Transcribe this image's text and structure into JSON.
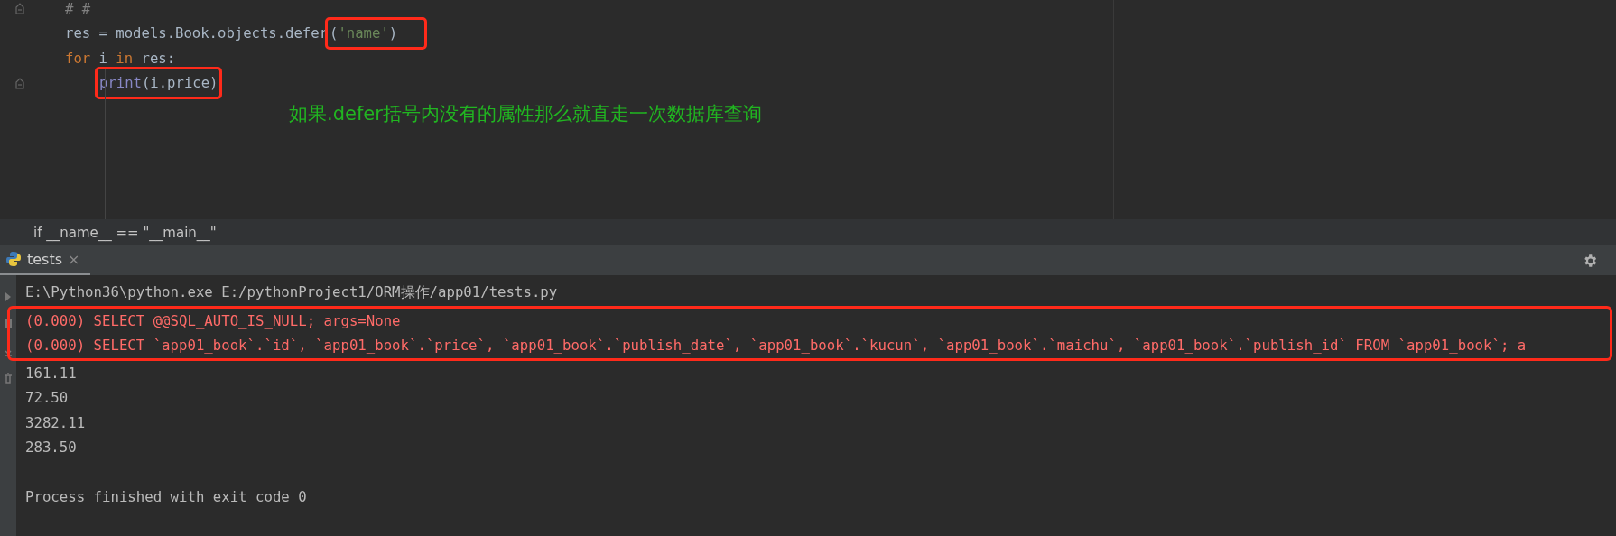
{
  "editor": {
    "lines": [
      {
        "fold": true,
        "indent": false,
        "segments": [
          {
            "text": "# #",
            "kind": "comment",
            "boxed": false
          }
        ]
      },
      {
        "fold": false,
        "indent": false,
        "segments": [
          {
            "text": "res = models.Book.objects.defer",
            "kind": "plain",
            "boxed": false
          },
          {
            "text": "(",
            "kind": "plain",
            "boxed": true
          },
          {
            "text": "'name'",
            "kind": "string",
            "boxed": true
          },
          {
            "text": ")",
            "kind": "plain",
            "boxed": true
          }
        ]
      },
      {
        "fold": false,
        "indent": false,
        "segments": [
          {
            "text": "for",
            "kind": "keyword",
            "boxed": false
          },
          {
            "text": " i ",
            "kind": "plain",
            "boxed": false
          },
          {
            "text": "in",
            "kind": "keyword",
            "boxed": false
          },
          {
            "text": " res:",
            "kind": "plain",
            "boxed": false
          }
        ]
      },
      {
        "fold": true,
        "indent": true,
        "segments": [
          {
            "text": "print",
            "kind": "builtin",
            "boxed": true
          },
          {
            "text": "(i.price)",
            "kind": "plain",
            "boxed": true
          }
        ]
      }
    ],
    "annotation": "如果.defer括号内没有的属性那么就直走一次数据库查询"
  },
  "breadcrumb": "if __name__ == \"__main__\"",
  "run_panel": {
    "tabs": [
      {
        "label": "tests",
        "selected": true,
        "close": "×"
      }
    ],
    "console": [
      {
        "text": "E:\\Python36\\python.exe E:/pythonProject1/ORM操作/app01/tests.py",
        "kind": "command",
        "boxed": false
      },
      {
        "text": "(0.000) SELECT @@SQL_AUTO_IS_NULL; args=None",
        "kind": "sql",
        "boxed": true
      },
      {
        "text": "(0.000) SELECT `app01_book`.`id`, `app01_book`.`price`, `app01_book`.`publish_date`, `app01_book`.`kucun`, `app01_book`.`maichu`, `app01_book`.`publish_id` FROM `app01_book`; a",
        "kind": "sql",
        "boxed": true
      },
      {
        "text": "161.11",
        "kind": "output",
        "boxed": false
      },
      {
        "text": "72.50",
        "kind": "output",
        "boxed": false
      },
      {
        "text": "3282.11",
        "kind": "output",
        "boxed": false
      },
      {
        "text": "283.50",
        "kind": "output",
        "boxed": false
      },
      {
        "text": "Process finished with exit code 0",
        "kind": "summary",
        "boxed": false
      }
    ]
  }
}
